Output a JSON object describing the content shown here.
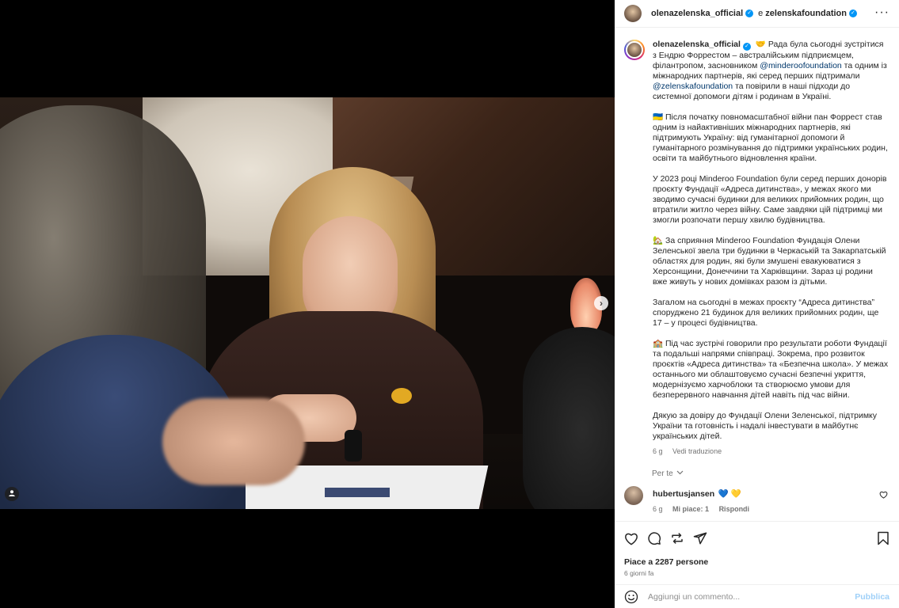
{
  "post": {
    "header": {
      "username": "olenazelenska_official",
      "conjunction": "e",
      "collaborator": "zelenskafoundation",
      "more_icon": "more-horizontal-icon"
    },
    "caption": {
      "username": "olenazelenska_official",
      "emoji_handshake": "🤝",
      "p1_a": "Рада була сьогодні зустрітися з Ендрю Форрестом – австралійським підприємцем, філантропом, засновником ",
      "p1_mention1": "@minderoofoundation",
      "p1_b": " та одним із міжнародних партнерів, які серед перших підтримали ",
      "p1_mention2": "@zelenskafoundation",
      "p1_c": " та повірили в наші підходи до системної допомоги дітям і родинам в Україні.",
      "p2": "🇺🇦 Після початку повномасштабної війни пан Форрест став одним із найактивніших міжнародних партнерів, які підтримують Україну: від гуманітарної допомоги й гуманітарного розмінування до підтримки українських родин, освіти та майбутнього відновлення країни.",
      "p3": "У 2023 році Minderoo Foundation були серед перших донорів проєкту Фундації «Адреса дитинства», у межах якого ми зводимо сучасні будинки для великих прийомних родин, що втратили житло через війну. Саме завдяки цій підтримці ми змогли розпочати першу хвилю будівництва.",
      "p4": "🏡 За сприяння Minderoo Foundation Фундація Олени Зеленської звела три будинки в Черкаській та Закарпатській областях для родин, які були змушені евакуюватися з Херсонщини, Донеччини та Харківщини. Зараз ці родини вже живуть у нових домівках разом із дітьми.",
      "p5": "Загалом на сьогодні в межах проєкту “Адреса дитинства” споруджено 21 будинок для великих прийомних родин, ще 17 – у процесі будівництва.",
      "p6": "🏫 Під час зустрічі говорили про результати роботи Фундації та подальші напрями співпраці. Зокрема, про розвиток проєктів «Адреса дитинства» та «Безпечна школа». У межах останнього ми облаштовуємо сучасні безпечні укриття, модернізуємо харчоблоки та створюємо умови для безперервного навчання дітей навіть під час війни.",
      "p7": "Дякую за довіру до Фундації Олени Зеленської, підтримку України та готовність і надалі інвестувати в майбутнє українських дітей.",
      "time": "6 g",
      "see_translation": "Vedi traduzione"
    },
    "per_te": "Per te",
    "comment": {
      "username": "hubertusjansen",
      "text": "💙 💛",
      "time": "6 g",
      "likes": "Mi piace: 1",
      "reply": "Rispondi"
    },
    "likes_text": "Piace a 2287 persone",
    "date_text": "6 giorni fa",
    "composer": {
      "placeholder": "Aggiungi un commento...",
      "publish": "Pubblica"
    }
  },
  "media": {
    "next_icon": "chevron-right-icon",
    "tag_icon": "user-tag-icon"
  },
  "colors": {
    "accent": "#0095f6",
    "mention": "#00376b",
    "muted": "#737373",
    "publish_disabled": "#9fd0f8"
  }
}
